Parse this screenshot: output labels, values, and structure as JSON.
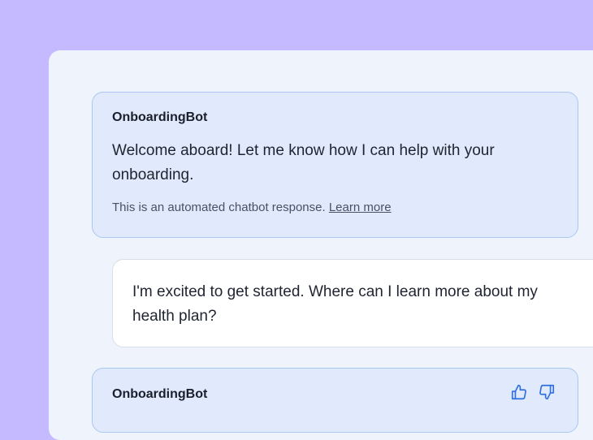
{
  "messages": [
    {
      "sender": "OnboardingBot",
      "text": "Welcome aboard! Let me know how I can help with your onboarding.",
      "disclaimer": "This is an automated chatbot response.",
      "learn_more": "Learn more"
    },
    {
      "sender": "user",
      "text": "I'm excited to get started. Where can I learn more about my health plan?"
    },
    {
      "sender": "OnboardingBot",
      "feedback_icons": [
        "thumbs-up-icon",
        "thumbs-down-icon"
      ]
    }
  ],
  "colors": {
    "background": "#c5b9ff",
    "panel": "#eff3fb",
    "bot_card": "#e0eafc",
    "bot_border": "#a9c8f0",
    "accent": "#2f6fe0"
  }
}
